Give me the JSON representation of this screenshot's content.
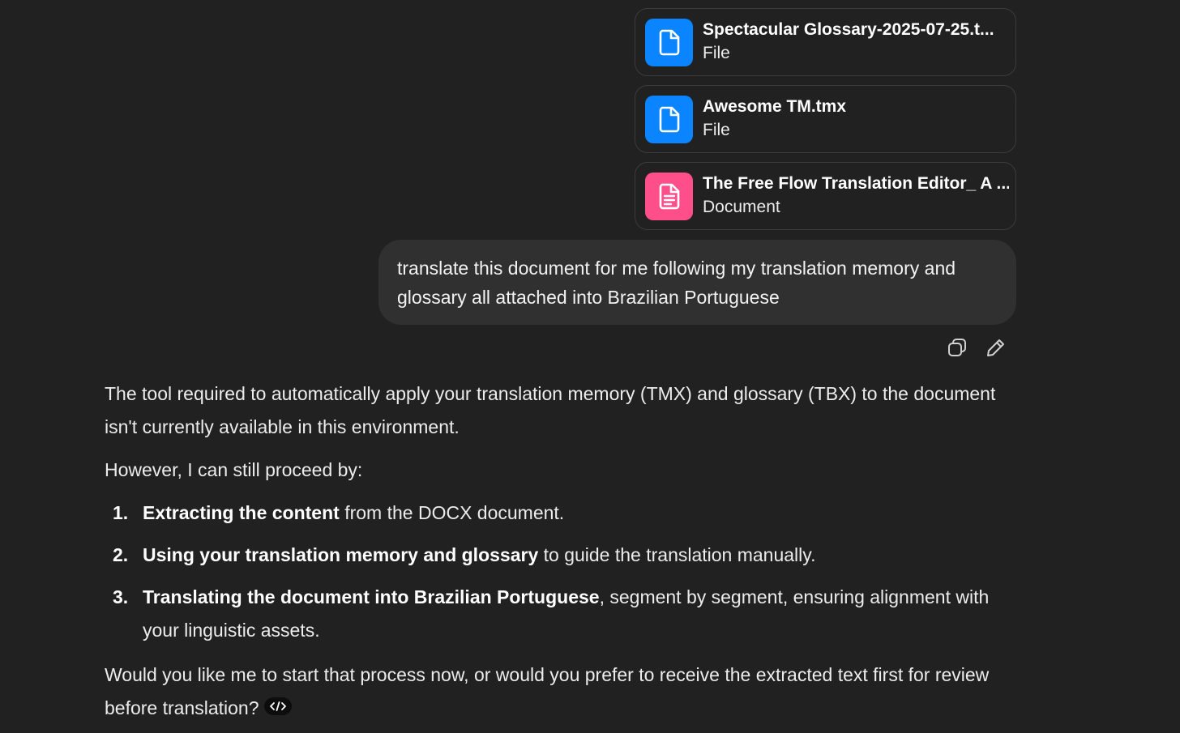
{
  "attachments": [
    {
      "name": "Spectacular Glossary-2025-07-25.t...",
      "type": "File",
      "icon": "file-icon",
      "color": "#0a84ff"
    },
    {
      "name": "Awesome TM.tmx",
      "type": "File",
      "icon": "file-icon",
      "color": "#0a84ff"
    },
    {
      "name": "The Free Flow Translation Editor_ A ...",
      "type": "Document",
      "icon": "document-icon",
      "color": "#ff4f8b"
    }
  ],
  "user_message": {
    "text": "translate this document for me following my translation memory and glossary all attached into Brazilian Portuguese"
  },
  "message_actions": {
    "copy_icon": "copy-icon",
    "edit_icon": "edit-icon"
  },
  "assistant": {
    "para1": "The tool required to automatically apply your translation memory (TMX) and glossary (TBX) to the document isn't currently available in this environment.",
    "para2": "However, I can still proceed by:",
    "steps": [
      {
        "num": "1.",
        "bold": "Extracting the content",
        "rest": " from the DOCX document."
      },
      {
        "num": "2.",
        "bold": "Using your translation memory and glossary",
        "rest": " to guide the translation manually."
      },
      {
        "num": "3.",
        "bold": "Translating the document into Brazilian Portuguese",
        "rest": ", segment by segment, ensuring alignment with your linguistic assets."
      }
    ],
    "para3": "Would you like me to start that process now, or would you prefer to receive the extracted text first for review before translation?",
    "code_icon": "code-icon"
  }
}
